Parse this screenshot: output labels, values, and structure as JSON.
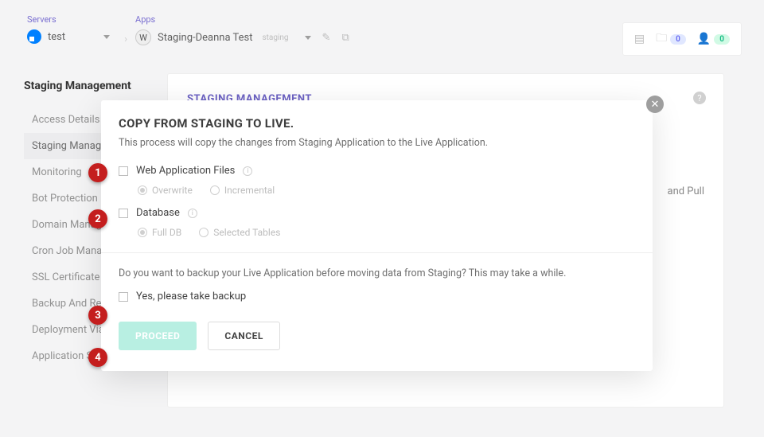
{
  "topbar": {
    "servers_label": "Servers",
    "server_name": "test",
    "apps_label": "Apps",
    "app_name": "Staging-Deanna Test",
    "app_env_badge": "staging",
    "right_badge_1": "0",
    "right_badge_2": "0"
  },
  "sidebar": {
    "title": "Staging Management",
    "items": [
      "Access Details",
      "Staging Management",
      "Monitoring",
      "Bot Protection",
      "Domain Management",
      "Cron Job Management",
      "SSL Certificate",
      "Backup And Restore",
      "Deployment Via Git",
      "Application Settings"
    ],
    "active_index": 1
  },
  "panel": {
    "title": "STAGING MANAGEMENT",
    "body_snippet": "and Pull"
  },
  "modal": {
    "title": "COPY FROM STAGING TO LIVE.",
    "desc": "This process will copy the changes from Staging Application to the Live Application.",
    "group1": {
      "label": "Web Application Files",
      "opt1": "Overwrite",
      "opt2": "Incremental"
    },
    "group2": {
      "label": "Database",
      "opt1": "Full DB",
      "opt2": "Selected Tables"
    },
    "backup_prompt": "Do you want to backup your Live Application before moving data from Staging? This may take a while.",
    "backup_label": "Yes, please take backup",
    "proceed": "PROCEED",
    "cancel": "CANCEL"
  },
  "annotations": [
    "1",
    "2",
    "3",
    "4"
  ]
}
